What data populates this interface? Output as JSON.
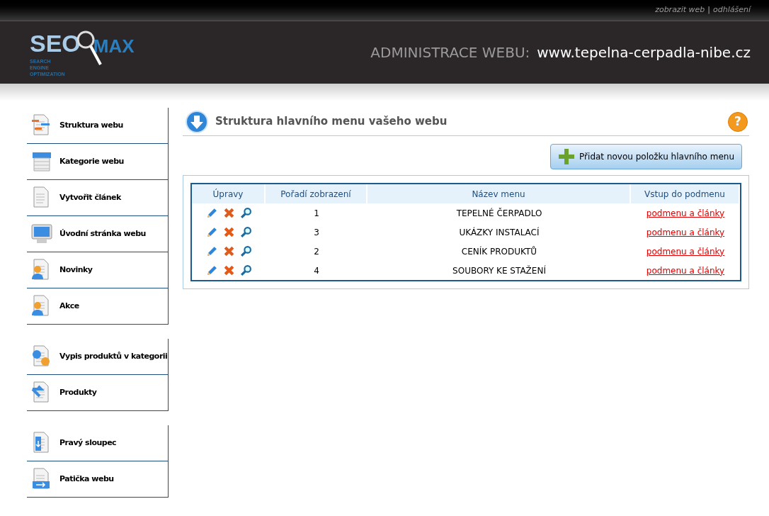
{
  "top_links": [
    "zobrazit web",
    "odhlášení"
  ],
  "top_separator": "|",
  "help": "?",
  "logo": {
    "seo": "SEO",
    "max": "MAX",
    "tagline": [
      "SEARCH",
      "ENGINE",
      "OPTIMIZATION"
    ]
  },
  "header": {
    "label": "ADMINISTRACE WEBU:",
    "site": "www.tepelna-cerpadla-nibe.cz"
  },
  "sidebar": {
    "groups": [
      [
        {
          "label": "Struktura webu",
          "kind": "structure"
        },
        {
          "label": "Kategorie webu",
          "kind": "category"
        },
        {
          "label": "Vytvořit článek",
          "kind": "document"
        },
        {
          "label": "Úvodní stránka webu",
          "kind": "monitor"
        },
        {
          "label": "Novinky",
          "kind": "person"
        },
        {
          "label": "Akce",
          "kind": "person"
        }
      ],
      [
        {
          "label": "Vypis produktů v kategorii",
          "kind": "product-list"
        },
        {
          "label": "Produkty",
          "kind": "product"
        }
      ],
      [
        {
          "label": "Pravý sloupec",
          "kind": "right-column"
        },
        {
          "label": "Patička webu",
          "kind": "footer"
        }
      ]
    ]
  },
  "page": {
    "title": "Struktura hlavního menu vašeho webu",
    "add_button": "Přidat novou položku hlavního menu"
  },
  "table": {
    "columns": [
      "Úpravy",
      "Pořadí zobrazení",
      "Název menu",
      "Vstup do podmenu"
    ],
    "rows": [
      {
        "order": "1",
        "name": "TEPELNÉ ČERPADLO",
        "link": "podmenu a články"
      },
      {
        "order": "3",
        "name": "UKÁZKY INSTALACÍ",
        "link": "podmenu a články"
      },
      {
        "order": "2",
        "name": "CENÍK PRODUKTŮ",
        "link": "podmenu a články"
      },
      {
        "order": "4",
        "name": "SOUBORY KE STAŽENÍ",
        "link": "podmenu a články"
      }
    ]
  }
}
